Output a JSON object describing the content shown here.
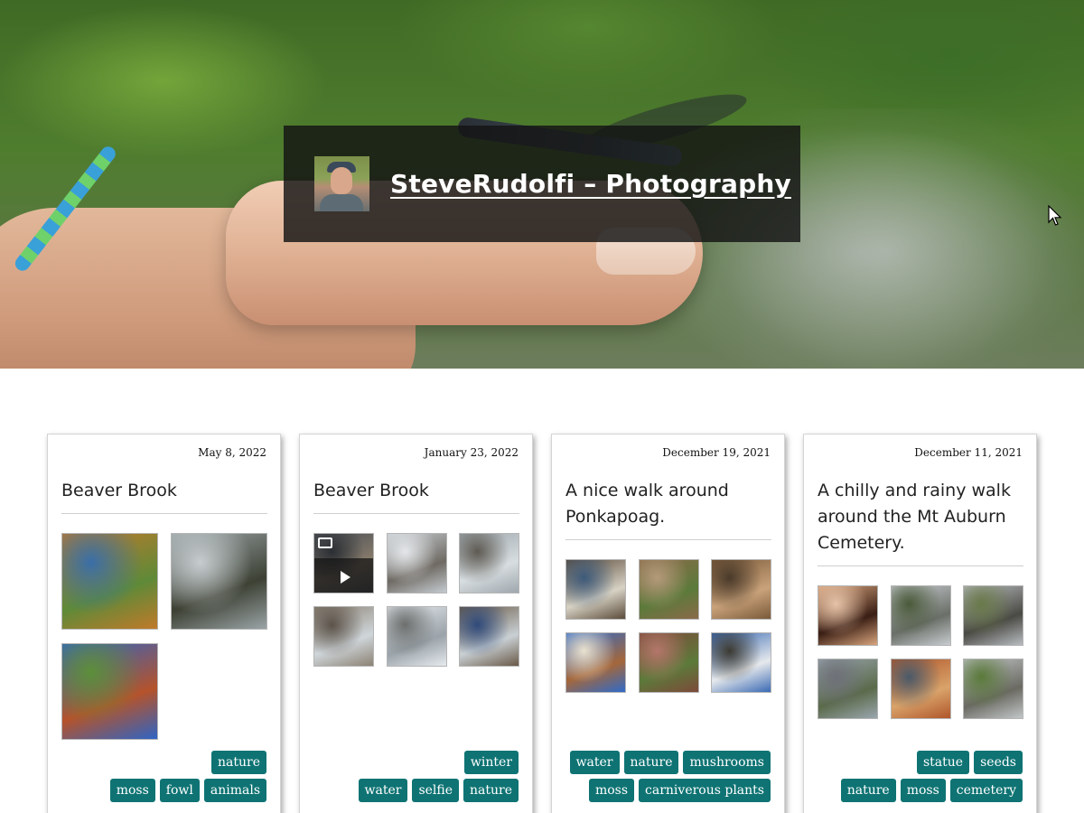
{
  "header": {
    "site_title": "SteveRudolfi – Photography"
  },
  "posts": [
    {
      "date": "May 8, 2022",
      "title": "Beaver Brook",
      "photos": [
        {
          "kind": "photo",
          "colors": [
            "#c07a2a",
            "#5e8a38",
            "#3a6ea8"
          ]
        },
        {
          "kind": "photo",
          "colors": [
            "#9aa4a6",
            "#3d4134",
            "#c7cdcf"
          ]
        },
        {
          "kind": "photo",
          "colors": [
            "#2f64c4",
            "#b5532b",
            "#5c8f3a"
          ]
        }
      ],
      "tags_row1": [
        "nature"
      ],
      "tags_row2": [
        "moss",
        "fowl",
        "animals"
      ]
    },
    {
      "date": "January 23, 2022",
      "title": "Beaver Brook",
      "photos": [
        {
          "kind": "video",
          "colors": [
            "#4a4f55",
            "#8a7d6c",
            "#2b2e33"
          ]
        },
        {
          "kind": "photo",
          "colors": [
            "#c5cbd0",
            "#6f6a63",
            "#e4e7ea"
          ]
        },
        {
          "kind": "photo",
          "colors": [
            "#9ea7ad",
            "#d7dde0",
            "#5e5a52"
          ]
        },
        {
          "kind": "photo",
          "colors": [
            "#8c8274",
            "#cfd6da",
            "#5c534a"
          ]
        },
        {
          "kind": "photo",
          "colors": [
            "#e6eaee",
            "#9aa3a9",
            "#6d6f6e"
          ]
        },
        {
          "kind": "photo",
          "colors": [
            "#6a5a48",
            "#c9d0d4",
            "#2f4a7a"
          ]
        }
      ],
      "tags_row1": [
        "winter"
      ],
      "tags_row2": [
        "water",
        "selfie",
        "nature"
      ]
    },
    {
      "date": "December 19, 2021",
      "title": "A nice walk around Ponkapoag.",
      "photos": [
        {
          "kind": "photo",
          "colors": [
            "#5b4b3a",
            "#d7d2c4",
            "#3d5a7a"
          ]
        },
        {
          "kind": "photo",
          "colors": [
            "#8a6a4a",
            "#5b7a3a",
            "#b49a7a"
          ]
        },
        {
          "kind": "photo",
          "colors": [
            "#7a5a3a",
            "#c9a27a",
            "#4a3a2a"
          ]
        },
        {
          "kind": "photo",
          "colors": [
            "#2f6ac8",
            "#a5673a",
            "#e9e2d0"
          ]
        },
        {
          "kind": "photo",
          "colors": [
            "#7c4a3a",
            "#5c7a3a",
            "#b4766a"
          ]
        },
        {
          "kind": "photo",
          "colors": [
            "#3a6ab4",
            "#e6e9ec",
            "#3c3a32"
          ]
        }
      ],
      "tags_row1": [
        "water",
        "nature",
        "mushrooms"
      ],
      "tags_row2": [
        "moss",
        "carniverous plants"
      ]
    },
    {
      "date": "December 11, 2021",
      "title": "A chilly and rainy walk around the Mt Auburn Cemetery.",
      "photos": [
        {
          "kind": "photo",
          "colors": [
            "#d8a57e",
            "#3a1e14",
            "#e6c3a8"
          ]
        },
        {
          "kind": "photo",
          "colors": [
            "#c8ccd0",
            "#6a6f68",
            "#4a5a3a"
          ]
        },
        {
          "kind": "photo",
          "colors": [
            "#b8bcc0",
            "#4a4a44",
            "#6a7a4a"
          ]
        },
        {
          "kind": "photo",
          "colors": [
            "#9aa6ae",
            "#5a6a4a",
            "#6e7078"
          ]
        },
        {
          "kind": "photo",
          "colors": [
            "#b0562a",
            "#d9a36a",
            "#4a5a6a"
          ]
        },
        {
          "kind": "photo",
          "colors": [
            "#c2c6c8",
            "#6a6a62",
            "#5a7a3a"
          ]
        }
      ],
      "tags_row1": [
        "statue",
        "seeds"
      ],
      "tags_row2": [
        "nature",
        "moss",
        "cemetery"
      ]
    }
  ]
}
